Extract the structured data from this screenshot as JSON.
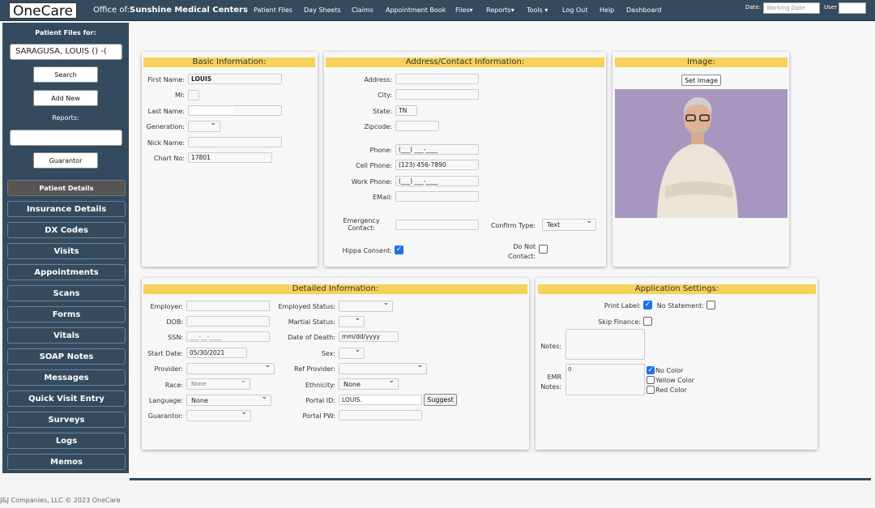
{
  "header": {
    "logo": "OneCare",
    "office_prefix": "Office of:",
    "office_name": "Sunshine Medical Centers",
    "nav": [
      "Patient Files",
      "Day Sheets",
      "Claims",
      "Appointment Book",
      "Files▾",
      "Reports▾",
      "Tools ▾",
      "Log Out",
      "Help",
      "Dashboard"
    ],
    "date_label": "Date:",
    "date_placeholder": "Working Date",
    "user_label": "User"
  },
  "sidebar": {
    "patient_files_for": "Patient Files for:",
    "patient_select": "SARAGUSA, LOUIS () -(",
    "search": "Search",
    "add_new": "Add New",
    "reports_label": "Reports:",
    "reports_select": "",
    "guarantor": "Guarantor",
    "items": [
      "Patient Details",
      "Insurance Details",
      "DX Codes",
      "Visits",
      "Appointments",
      "Scans",
      "Forms",
      "Vitals",
      "SOAP Notes",
      "Messages",
      "Quick Visit Entry",
      "Surveys",
      "Logs",
      "Memos"
    ],
    "active": "Patient Details"
  },
  "basic": {
    "title": "Basic Information:",
    "first_name_label": "First Name:",
    "first_name": "LOUIS",
    "mi_label": "MI:",
    "last_name_label": "Last Name:",
    "generation_label": "Generation:",
    "nick_label": "Nick Name:",
    "chart_label": "Chart No:",
    "chart_no": "17801"
  },
  "address": {
    "title": "Address/Contact Information:",
    "address_label": "Address:",
    "city_label": "City:",
    "state_label": "State:",
    "state": "TN",
    "zip_label": "Zipcode:",
    "phone_label": "Phone:",
    "phone": "(___) ___-____",
    "cell_label": "Cell Phone:",
    "cell": "(123) 456-7890",
    "work_label": "Work Phone:",
    "work": "(___) ___-____",
    "email_label": "EMail:",
    "emergency_label1": "Emergency",
    "emergency_label2": "Contact:",
    "confirm_label": "Confirm Type:",
    "confirm_value": "Text",
    "hippa_label": "Hippa Consent:",
    "hippa_checked": true,
    "dnc_label1": "Do Not",
    "dnc_label2": "Contact:",
    "dnc_checked": false
  },
  "image": {
    "title": "Image:",
    "set_image": "Set Image"
  },
  "detailed": {
    "title": "Detailed Information:",
    "employer_label": "Employer:",
    "dob_label": "DOB:",
    "ssn_label": "SSN:",
    "ssn": "___-__-____",
    "start_label": "Start Date:",
    "start": "05/30/2021",
    "provider_label": "Provider:",
    "race_label": "Race:",
    "race": "None",
    "language_label": "Language:",
    "language": "None",
    "guarantor_label": "Guarantor:",
    "employed_label": "Employed Status:",
    "marital_label": "Martial Status:",
    "death_label": "Date of Death:",
    "death": "mm/dd/yyyy",
    "sex_label": "Sex:",
    "ref_label": "Ref Provider:",
    "ethnicity_label": "Ethnicity:",
    "ethnicity": "None",
    "portal_id_label": "Portal ID:",
    "portal_id": "LOUIS.",
    "suggest": "Suggest",
    "portal_pw_label": "Portal PW:"
  },
  "app": {
    "title": "Application Settings:",
    "print_label": "Print Label:",
    "print_checked": true,
    "no_statement": "No Statement:",
    "skip_finance": "Skip Finance:",
    "notes_label": "Notes:",
    "emr_label1": "EMR",
    "emr_label2": "Notes:",
    "emr_value": "0",
    "no_color": "No Color",
    "yellow_color": "Yellow Color",
    "red_color": "Red Color"
  },
  "footer": "J&J Companies, LLC © 2023 OneCare",
  "colors": {
    "nav": "#344a5f",
    "section_header": "#f5d35a",
    "check": "#1a73e8"
  }
}
